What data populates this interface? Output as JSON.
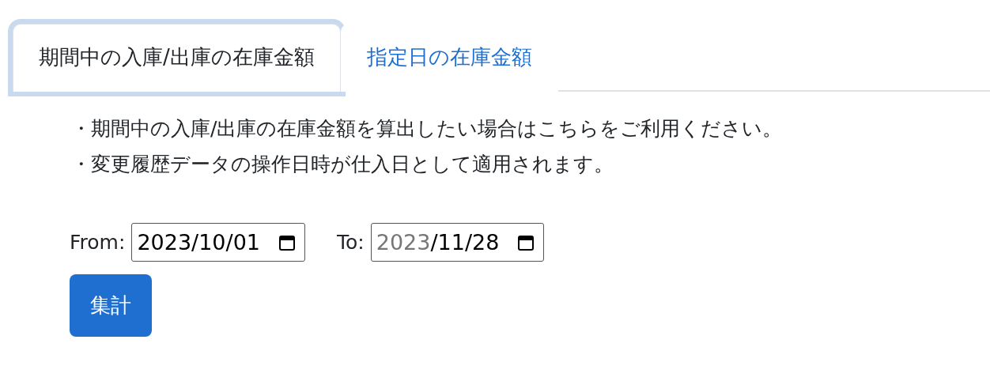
{
  "tabs": [
    {
      "label": "期間中の入庫/出庫の在庫金額",
      "selected": true,
      "focused": true
    },
    {
      "label": "指定日の在庫金額",
      "selected": false,
      "focused": false
    }
  ],
  "notes": [
    "・期間中の入庫/出庫の在庫金額を算出したい場合はこちらをご利用ください。",
    "・変更履歴データの操作日時が仕入日として適用されます。"
  ],
  "fields": [
    {
      "label": "From:",
      "segments": [
        {
          "text": "2023/10/01",
          "dimmed": false
        }
      ]
    },
    {
      "label": "To:",
      "segments": [
        {
          "text": "2023",
          "dimmed": true
        },
        {
          "text": "/11/28",
          "dimmed": false
        }
      ]
    }
  ],
  "submit": "集計"
}
